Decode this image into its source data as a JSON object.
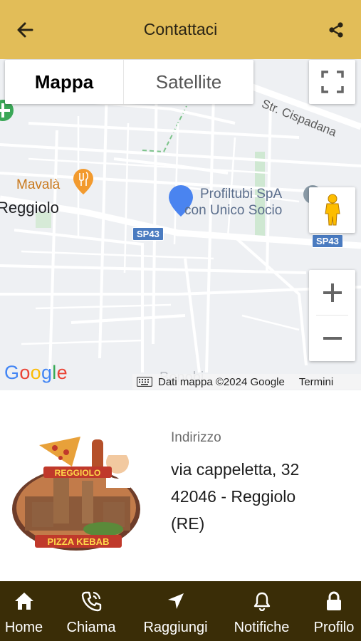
{
  "header": {
    "title": "Contattaci",
    "background_color": "#e2bd58",
    "back_icon": "arrow-left-icon",
    "share_icon": "share-icon"
  },
  "map": {
    "maptype_options": [
      {
        "label": "Mappa",
        "selected": true
      },
      {
        "label": "Satellite",
        "selected": false
      }
    ],
    "labels": {
      "road_cispadana": "Str. Cispadana",
      "place_mavala": "Mavalà",
      "town": "Reggiolo",
      "poi_line1": "Profiltubi SpA",
      "poi_line2": "con Unico Socio",
      "shield_left": "SP43",
      "shield_right": "SP43",
      "faded": "Bonobi"
    },
    "google_logo": "Google",
    "attribution": "Dati mappa ©2024 Google",
    "terms": "Termini",
    "controls": [
      "fullscreen-icon",
      "pegman-icon",
      "zoom-in-icon",
      "zoom-out-icon"
    ],
    "marker_color": "#4a84f0"
  },
  "contact": {
    "address_label": "Indirizzo",
    "address_line1": "via cappeletta, 32",
    "address_line2": "42046 - Reggiolo",
    "address_line3": "(RE)",
    "logo_top_text": "REGGIOLO",
    "logo_bottom_text": "PIZZA KEBAB"
  },
  "bottom_nav": {
    "background_color": "#3a2d07",
    "items": [
      {
        "label": "Home",
        "icon": "home-icon"
      },
      {
        "label": "Chiama",
        "icon": "phone-icon"
      },
      {
        "label": "Raggiungi",
        "icon": "navigation-arrow-icon"
      },
      {
        "label": "Notifiche",
        "icon": "bell-icon"
      },
      {
        "label": "Profilo",
        "icon": "lock-icon"
      }
    ]
  }
}
